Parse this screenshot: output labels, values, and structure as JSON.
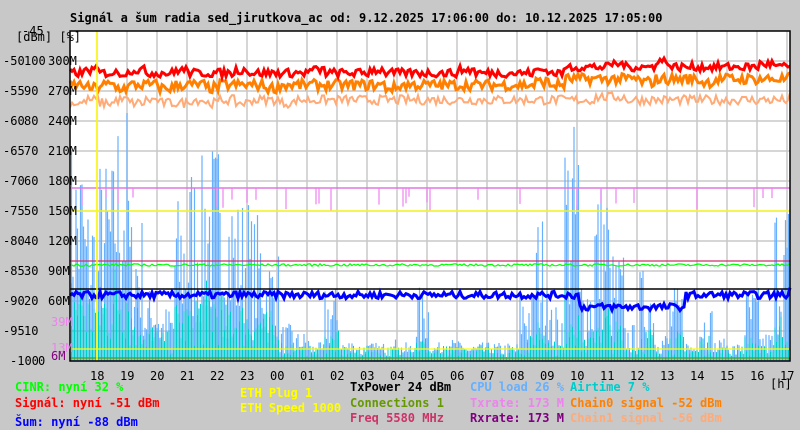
{
  "chart_data": {
    "type": "line",
    "title": "Signál a šum radia sed_jirutkova_ac od: 9.12.2025 17:06:00 do: 10.12.2025 17:05:00",
    "ylabel": "[dBm] [%]",
    "xlabel": "[h]",
    "y_dbm_ticks": [
      "-45",
      "-50",
      "-55",
      "-60",
      "-65",
      "-70",
      "-75",
      "-80",
      "-85",
      "-90",
      "-95",
      "-100"
    ],
    "y_pct_ticks": [
      "100",
      "90",
      "80",
      "70",
      "60",
      "50",
      "40",
      "30",
      "20",
      "10",
      "0"
    ],
    "y_rate_ticks": [
      "300M",
      "270M",
      "240M",
      "210M",
      "180M",
      "150M",
      "120M",
      "90M",
      "60M"
    ],
    "y_rate_extra": [
      "39M",
      "13M",
      "6M"
    ],
    "ylim_dbm": [
      -100,
      -45
    ],
    "ylim_pct": [
      0,
      110
    ],
    "ylim_rate": [
      0,
      330
    ],
    "x_ticks": [
      "18",
      "19",
      "20",
      "21",
      "22",
      "23",
      "00",
      "01",
      "02",
      "03",
      "04",
      "05",
      "06",
      "07",
      "08",
      "09",
      "10",
      "11",
      "12",
      "13",
      "14",
      "15",
      "16",
      "17"
    ],
    "x_start_hour": 17.1,
    "x_step_hours": 0.5,
    "marker_hour": 18.0,
    "grid": true,
    "series": [
      {
        "name": "Signál",
        "unit": "dBm",
        "color": "#ff0000",
        "values": [
          -52,
          -51.5,
          -52,
          -52,
          -51.5,
          -52,
          -52,
          -51.5,
          -52,
          -52,
          -52,
          -51.5,
          -52,
          -52,
          -52,
          -52,
          -51.5,
          -52,
          -52,
          -52,
          -51.5,
          -52,
          -52,
          -52,
          -52,
          -52,
          -51.5,
          -52,
          -52,
          -52,
          -52,
          -51.5,
          -52,
          -51,
          -51,
          -51,
          -50.5,
          -51,
          -51,
          -50,
          -51,
          -51,
          -51,
          -51,
          -51,
          -51,
          -50.5,
          -51,
          -51
        ]
      },
      {
        "name": "Chain0 signal",
        "unit": "dBm",
        "color": "#ff8000",
        "values": [
          -54,
          -54.5,
          -54,
          -54.5,
          -54,
          -54,
          -54.5,
          -54,
          -54,
          -54.5,
          -54,
          -54,
          -54,
          -54.5,
          -54,
          -54,
          -54,
          -54,
          -54,
          -54,
          -54,
          -54.5,
          -54,
          -54,
          -54,
          -54,
          -54,
          -54,
          -54,
          -54,
          -54,
          -53.5,
          -54,
          -53,
          -53,
          -53,
          -53,
          -53,
          -53.5,
          -53,
          -53,
          -53,
          -53.5,
          -53,
          -53,
          -53,
          -53,
          -53,
          -52
        ]
      },
      {
        "name": "Chain1 signal",
        "unit": "dBm",
        "color": "#ffaa77",
        "values": [
          -57,
          -56.5,
          -57,
          -56.5,
          -57,
          -56.5,
          -57,
          -57,
          -56.5,
          -57,
          -56.5,
          -57,
          -56.5,
          -56.5,
          -57,
          -56.5,
          -56.5,
          -56.5,
          -56.5,
          -56.5,
          -56.5,
          -56.5,
          -56.5,
          -56.5,
          -56.5,
          -56.5,
          -56.5,
          -56.5,
          -56.5,
          -56.5,
          -56.5,
          -56.5,
          -56.5,
          -56.5,
          -56.5,
          -56,
          -56,
          -56.5,
          -56.5,
          -56.5,
          -56.5,
          -56.5,
          -56.5,
          -56.5,
          -56.5,
          -56.5,
          -56.5,
          -56.5,
          -56
        ]
      },
      {
        "name": "Šum",
        "unit": "dBm",
        "color": "#0000ff",
        "values": [
          -89,
          -89,
          -89,
          -89,
          -89,
          -89,
          -89,
          -89,
          -89,
          -89,
          -89,
          -89,
          -89,
          -89,
          -89,
          -89,
          -89,
          -89,
          -89,
          -89,
          -89,
          -89,
          -89,
          -89,
          -89,
          -89,
          -89,
          -89,
          -89,
          -89,
          -89,
          -89,
          -89,
          -89,
          -91,
          -91,
          -91,
          -91,
          -91,
          -91,
          -91,
          -89,
          -89,
          -89,
          -89,
          -89,
          -89,
          -89,
          -88
        ]
      },
      {
        "name": "CPU load",
        "unit": "%",
        "color": "#66b0ff",
        "values": [
          60,
          45,
          55,
          70,
          40,
          20,
          15,
          45,
          55,
          60,
          50,
          45,
          40,
          30,
          10,
          8,
          5,
          20,
          6,
          5,
          5,
          6,
          5,
          20,
          5,
          6,
          5,
          5,
          5,
          5,
          20,
          40,
          15,
          65,
          25,
          50,
          30,
          10,
          25,
          8,
          20,
          6,
          15,
          6,
          5,
          20,
          8,
          45,
          50
        ]
      },
      {
        "name": "Airtime",
        "unit": "%",
        "color": "#00cccc",
        "values": [
          18,
          15,
          16,
          20,
          12,
          8,
          6,
          12,
          15,
          16,
          14,
          12,
          12,
          10,
          4,
          3,
          3,
          6,
          3,
          3,
          3,
          3,
          3,
          5,
          3,
          3,
          3,
          3,
          3,
          3,
          5,
          10,
          4,
          15,
          6,
          12,
          8,
          4,
          7,
          3,
          6,
          3,
          5,
          3,
          3,
          5,
          3,
          10,
          7
        ]
      },
      {
        "name": "CINR",
        "unit": "%",
        "color": "#00ff00",
        "values": [
          32,
          32,
          32,
          32,
          32,
          32,
          32,
          32,
          32,
          32,
          32,
          32,
          32,
          32,
          32,
          32,
          32,
          32,
          32,
          32,
          32,
          32,
          32,
          32,
          32,
          32,
          32,
          32,
          32,
          32,
          32,
          32,
          32,
          32,
          32,
          32,
          32,
          32,
          32,
          32,
          32,
          32,
          32,
          32,
          32,
          32,
          32,
          32,
          32
        ]
      }
    ],
    "constant_lines": [
      {
        "name": "Rxrate",
        "value_rate_M": 173,
        "color": "#800080"
      },
      {
        "name": "Txrate",
        "value_rate_M": 173,
        "color": "#ee82ee"
      },
      {
        "name": "ETH Speed",
        "value_rate_M": 150,
        "color": "#ffff00"
      },
      {
        "name": "Freq",
        "value_rate_M": 100,
        "color": "#cc3366"
      },
      {
        "name": "TxPower",
        "value_pct": 24,
        "color": "#000000"
      },
      {
        "name": "ETH Plug",
        "value_pct": 4,
        "color": "#ffff00"
      },
      {
        "name": "Connections",
        "value_pct": 1,
        "color": "#669900"
      }
    ]
  },
  "legend": {
    "cinr": "CINR: nyní 32 %",
    "signal": "Signál: nyní -51 dBm",
    "noise": "Šum: nyní -88 dBm",
    "eth_plug": "ETH Plug 1",
    "eth_speed": "ETH Speed 1000",
    "txpower": "TxPower 24 dBm",
    "connections": "Connections 1",
    "freq": "Freq 5580 MHz",
    "cpu": "CPU load 26 %",
    "txrate": "Txrate: 173 M",
    "rxrate": "Rxrate: 173 M",
    "airtime": "Airtime 7 %",
    "chain0": "Chain0 signal -52 dBm",
    "chain1": "Chain1 signal -56 dBm"
  }
}
